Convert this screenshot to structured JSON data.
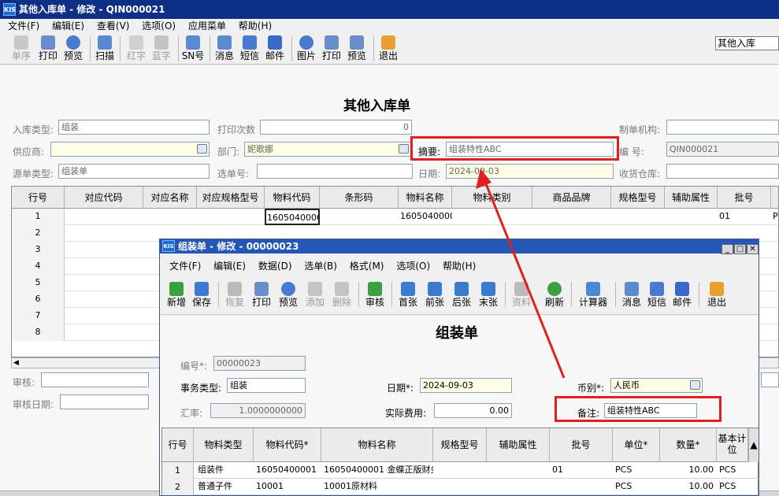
{
  "main_window": {
    "title": "其他入库单 - 修改 - QIN000021",
    "logo": "KIS",
    "menu": [
      "文件(F)",
      "编辑(E)",
      "查看(V)",
      "选项(O)",
      "应用菜单",
      "帮助(H)"
    ],
    "toolbar": [
      {
        "label": "单序",
        "icon": "sort-icon",
        "enabled": false
      },
      {
        "label": "打印",
        "icon": "print-icon",
        "enabled": true
      },
      {
        "label": "预览",
        "icon": "preview-icon",
        "enabled": true
      },
      {
        "label": "扫描",
        "icon": "scan-icon",
        "enabled": true
      },
      {
        "label": "红字",
        "icon": "red-a-icon",
        "enabled": false
      },
      {
        "label": "蓝字",
        "icon": "blue-a-icon",
        "enabled": false
      },
      {
        "label": "SN号",
        "icon": "sn-icon",
        "enabled": true
      },
      {
        "label": "消息",
        "icon": "message-icon",
        "enabled": true
      },
      {
        "label": "短信",
        "icon": "sms-icon",
        "enabled": true
      },
      {
        "label": "邮件",
        "icon": "mail-icon",
        "enabled": true
      },
      {
        "label": "图片",
        "icon": "picture-icon",
        "enabled": true
      },
      {
        "label": "打印",
        "icon": "print2-icon",
        "enabled": true
      },
      {
        "label": "预览",
        "icon": "preview2-icon",
        "enabled": true
      },
      {
        "label": "退出",
        "icon": "exit-icon",
        "enabled": true
      }
    ],
    "doc_type_select": "其他入库",
    "form_title": "其他入库单",
    "fields": {
      "in_type_label": "入库类型:",
      "in_type_value": "组装",
      "print_count_label": "打印次数",
      "print_count_value": "0",
      "maker_org_label": "制单机构:",
      "maker_org_value": "",
      "supplier_label": "供应商:",
      "supplier_value": "",
      "dept_label": "部门:",
      "dept_value": "妮歌娜",
      "summary_label": "摘要:",
      "summary_value": "组装特性ABC",
      "number_label": "编    号:",
      "number_value": "QIN000021",
      "src_type_label": "源单类型:",
      "src_type_value": "组装单",
      "sel_no_label": "选单号:",
      "sel_no_value": "",
      "date_label": "日期:",
      "date_value": "2024-09-03",
      "warehouse_label": "收货仓库:",
      "warehouse_value": "",
      "audit_label": "审核:",
      "audit_value": "",
      "audit_date_label": "审核日期:",
      "audit_date_value": ""
    },
    "grid": {
      "headers": [
        "行号",
        "对应代码",
        "对应名称",
        "对应规格型号",
        "物料代码",
        "条形码",
        "物料名称",
        "物料类别",
        "商品品牌",
        "规格型号",
        "辅助属性",
        "批号",
        "P"
      ],
      "rows": [
        {
          "n": "1",
          "code": "16050400001",
          "name": "16050400001",
          "batch": "01",
          "unit": "P"
        },
        {
          "n": "2"
        },
        {
          "n": "3"
        },
        {
          "n": "4"
        },
        {
          "n": "5"
        },
        {
          "n": "6"
        },
        {
          "n": "7"
        },
        {
          "n": "8"
        }
      ]
    }
  },
  "dialog": {
    "title": "组装单 - 修改 - 00000023",
    "logo": "KIS",
    "menu": [
      "文件(F)",
      "编辑(E)",
      "数据(D)",
      "选单(B)",
      "格式(M)",
      "选项(O)",
      "帮助(H)"
    ],
    "toolbar": [
      {
        "label": "新增",
        "icon": "new-icon",
        "enabled": true
      },
      {
        "label": "保存",
        "icon": "save-icon",
        "enabled": true
      },
      {
        "label": "恢复",
        "icon": "undo-icon",
        "enabled": false
      },
      {
        "label": "打印",
        "icon": "print-icon",
        "enabled": true
      },
      {
        "label": "预览",
        "icon": "preview-icon",
        "enabled": true
      },
      {
        "label": "添加",
        "icon": "add-row-icon",
        "enabled": false
      },
      {
        "label": "删除",
        "icon": "delete-row-icon",
        "enabled": false
      },
      {
        "label": "审核",
        "icon": "audit-icon",
        "enabled": true
      },
      {
        "label": "首张",
        "icon": "first-icon",
        "enabled": true
      },
      {
        "label": "前张",
        "icon": "prev-icon",
        "enabled": true
      },
      {
        "label": "后张",
        "icon": "next-icon",
        "enabled": true
      },
      {
        "label": "末张",
        "icon": "last-icon",
        "enabled": true
      },
      {
        "label": "资料",
        "icon": "data-icon",
        "enabled": false
      },
      {
        "label": "刷新",
        "icon": "refresh-icon",
        "enabled": true
      },
      {
        "label": "计算器",
        "icon": "calculator-icon",
        "enabled": true
      },
      {
        "label": "消息",
        "icon": "message-icon",
        "enabled": true
      },
      {
        "label": "短信",
        "icon": "sms-icon",
        "enabled": true
      },
      {
        "label": "邮件",
        "icon": "mail-icon",
        "enabled": true
      },
      {
        "label": "退出",
        "icon": "exit-icon",
        "enabled": true
      }
    ],
    "form_title": "组装单",
    "fields": {
      "number_label": "编号*:",
      "number_value": "00000023",
      "biz_type_label": "事务类型:",
      "biz_type_value": "组装",
      "date_label": "日期*:",
      "date_value": "2024-09-03",
      "currency_label": "币别*:",
      "currency_value": "人民币",
      "rate_label": "汇率:",
      "rate_value": "1.0000000000",
      "actual_fee_label": "实际费用:",
      "actual_fee_value": "0.00",
      "remark_label": "备注:",
      "remark_value": "组装特性ABC"
    },
    "grid": {
      "headers": [
        "行号",
        "物料类型",
        "物料代码*",
        "物料名称",
        "规格型号",
        "辅助属性",
        "批号",
        "单位*",
        "数量*",
        "基本计位"
      ],
      "rows": [
        {
          "n": "1",
          "type": "组装件",
          "code": "16050400001",
          "name": "16050400001 金蝶正版财务",
          "batch": "01",
          "unit": "PCS",
          "qty": "10.00",
          "base": "PCS"
        },
        {
          "n": "2",
          "type": "普通子件",
          "code": "10001",
          "name": "10001原材料",
          "batch": "",
          "unit": "PCS",
          "qty": "10.00",
          "base": "PCS"
        }
      ]
    }
  },
  "colors": {
    "highlight": "#e02020",
    "titlebar": "#0d2f86",
    "dialog_title": "#2456b6"
  }
}
